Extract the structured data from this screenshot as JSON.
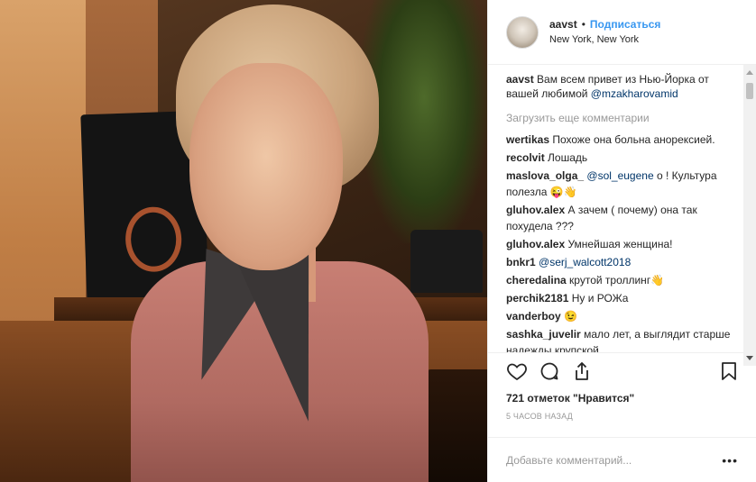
{
  "header": {
    "username": "aavst",
    "separator": "•",
    "follow_label": "Подписаться",
    "location": "New York, New York"
  },
  "caption": {
    "username": "aavst",
    "text": " Вам всем привет из Нью-Йорка от вашей любимой ",
    "mention": "@mzakharovamid"
  },
  "load_more": "Загрузить еще комментарии",
  "comments": [
    {
      "user": "wertikas",
      "text": " Похоже она больна анорексией.",
      "mention": ""
    },
    {
      "user": "recolvit",
      "text": " Лошадь",
      "mention": ""
    },
    {
      "user": "maslova_olga_",
      "text": " о ! Культура полезла 😜👋",
      "mention": " @sol_eugene"
    },
    {
      "user": "gluhov.alex",
      "text": " А зачем ( почему) она так похудела ???",
      "mention": ""
    },
    {
      "user": "gluhov.alex",
      "text": " Умнейшая женщина!",
      "mention": ""
    },
    {
      "user": "bnkr1",
      "text": "",
      "mention": " @serj_walcott2018"
    },
    {
      "user": "cheredalina",
      "text": " крутой троллинг👋",
      "mention": ""
    },
    {
      "user": "perchik2181",
      "text": " Ну и РОЖа",
      "mention": ""
    },
    {
      "user": "vanderboy",
      "text": " 😉",
      "mention": ""
    },
    {
      "user": "sashka_juvelir",
      "text": " мало лет, а выглядит старше надежды крупской",
      "mention": ""
    }
  ],
  "actions": {
    "like_icon": "heart-icon",
    "comment_icon": "comment-icon",
    "share_icon": "share-icon",
    "save_icon": "bookmark-icon"
  },
  "likes": "721 отметок \"Нравится\"",
  "time": "5 ЧАСОВ НАЗАД",
  "add_comment": {
    "placeholder": "Добавьте комментарий...",
    "more": "•••"
  },
  "colors": {
    "link": "#3897f0",
    "mention": "#003569",
    "muted": "#999999"
  }
}
